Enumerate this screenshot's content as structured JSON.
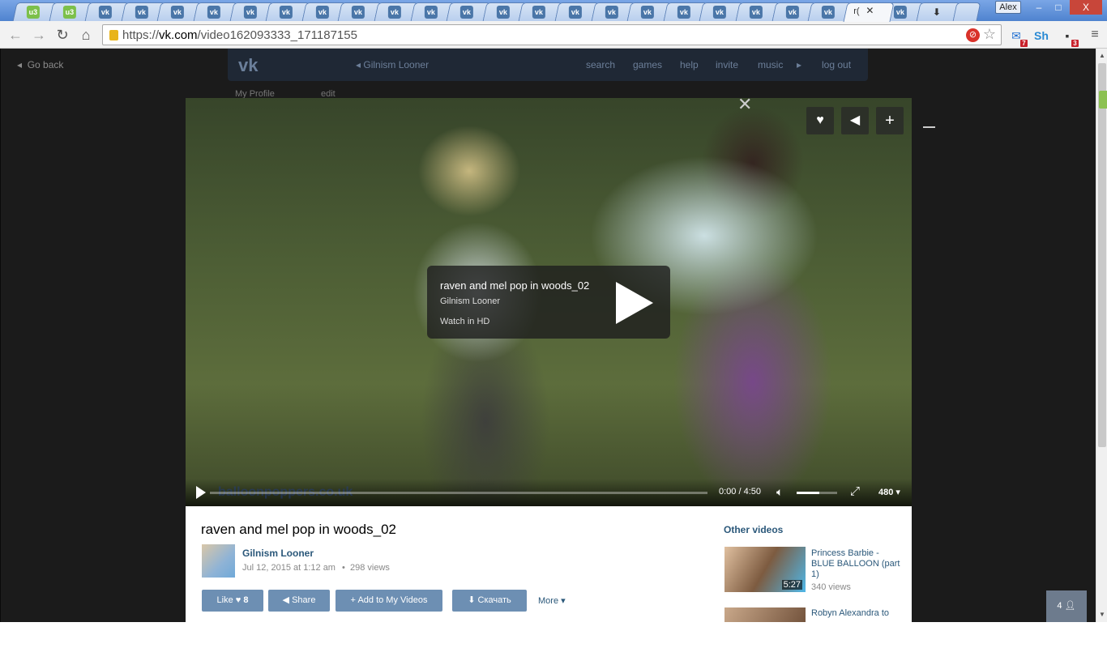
{
  "browser": {
    "tabs": [
      {
        "favicon": "u3"
      },
      {
        "favicon": "u3"
      },
      {
        "favicon": "vk"
      },
      {
        "favicon": "vk"
      },
      {
        "favicon": "vk"
      },
      {
        "favicon": "vk"
      },
      {
        "favicon": "vk"
      },
      {
        "favicon": "vk"
      },
      {
        "favicon": "vk"
      },
      {
        "favicon": "vk"
      },
      {
        "favicon": "vk"
      },
      {
        "favicon": "vk"
      },
      {
        "favicon": "vk"
      },
      {
        "favicon": "vk"
      },
      {
        "favicon": "vk"
      },
      {
        "favicon": "vk"
      },
      {
        "favicon": "vk"
      },
      {
        "favicon": "vk"
      },
      {
        "favicon": "vk"
      },
      {
        "favicon": "vk"
      },
      {
        "favicon": "vk"
      },
      {
        "favicon": "vk"
      },
      {
        "favicon": "vk"
      }
    ],
    "active_tab_title": "r(",
    "active_tab_close": "✕",
    "after_tabs": [
      {
        "favicon": "vk"
      },
      {
        "favicon": "download"
      }
    ],
    "user": "Alex",
    "window_controls": {
      "minimize": "–",
      "maximize": "□",
      "close": "X"
    },
    "url_scheme": "https://",
    "url_host": "vk.com",
    "url_path": "/video162093333_171187155",
    "extensions": [
      {
        "icon": "mail-icon",
        "label": "✉",
        "badge": "7",
        "color": "#1f6fd1"
      },
      {
        "icon": "sh-icon",
        "label": "Sh",
        "badge": "",
        "color": "#2a8ad4"
      },
      {
        "icon": "puzzle-icon",
        "label": "▪",
        "badge": "3",
        "color": "#333333"
      }
    ]
  },
  "vk_background": {
    "go_back": "Go back",
    "title": "Gilnism Looner",
    "nav": [
      "search",
      "games",
      "help",
      "invite",
      "music",
      "log out"
    ],
    "my_profile": "My Profile",
    "edit": "edit"
  },
  "video": {
    "overlay_title": "raven and mel pop in woods_02",
    "overlay_author": "Gilnism Looner",
    "overlay_hd": "Watch in HD",
    "watermark": "balloonpoppers.co.uk",
    "time": "0:00 / 4:50",
    "progress_fraction": 0,
    "volume_fraction": 0.55,
    "quality": "480"
  },
  "info": {
    "title": "raven and mel pop in woods_02",
    "author": "Gilnism Looner",
    "date": "Jul 12, 2015 at 1:12 am",
    "views": "298 views",
    "like_label": "Like",
    "like_count": "8",
    "share_label": "Share",
    "add_label": "Add to My Videos",
    "download_label": "Скачать",
    "more_label": "More"
  },
  "other_videos": {
    "heading": "Other videos",
    "items": [
      {
        "title": "Princess Barbie - BLUE BALLOON (part 1)",
        "duration": "5:27",
        "views": "340 views"
      },
      {
        "title": "Robyn Alexandra to",
        "duration": "",
        "views": ""
      }
    ]
  },
  "online_count": "4",
  "colors": {
    "vk_blue": "#2b587a",
    "button": "#6d8fb3"
  }
}
